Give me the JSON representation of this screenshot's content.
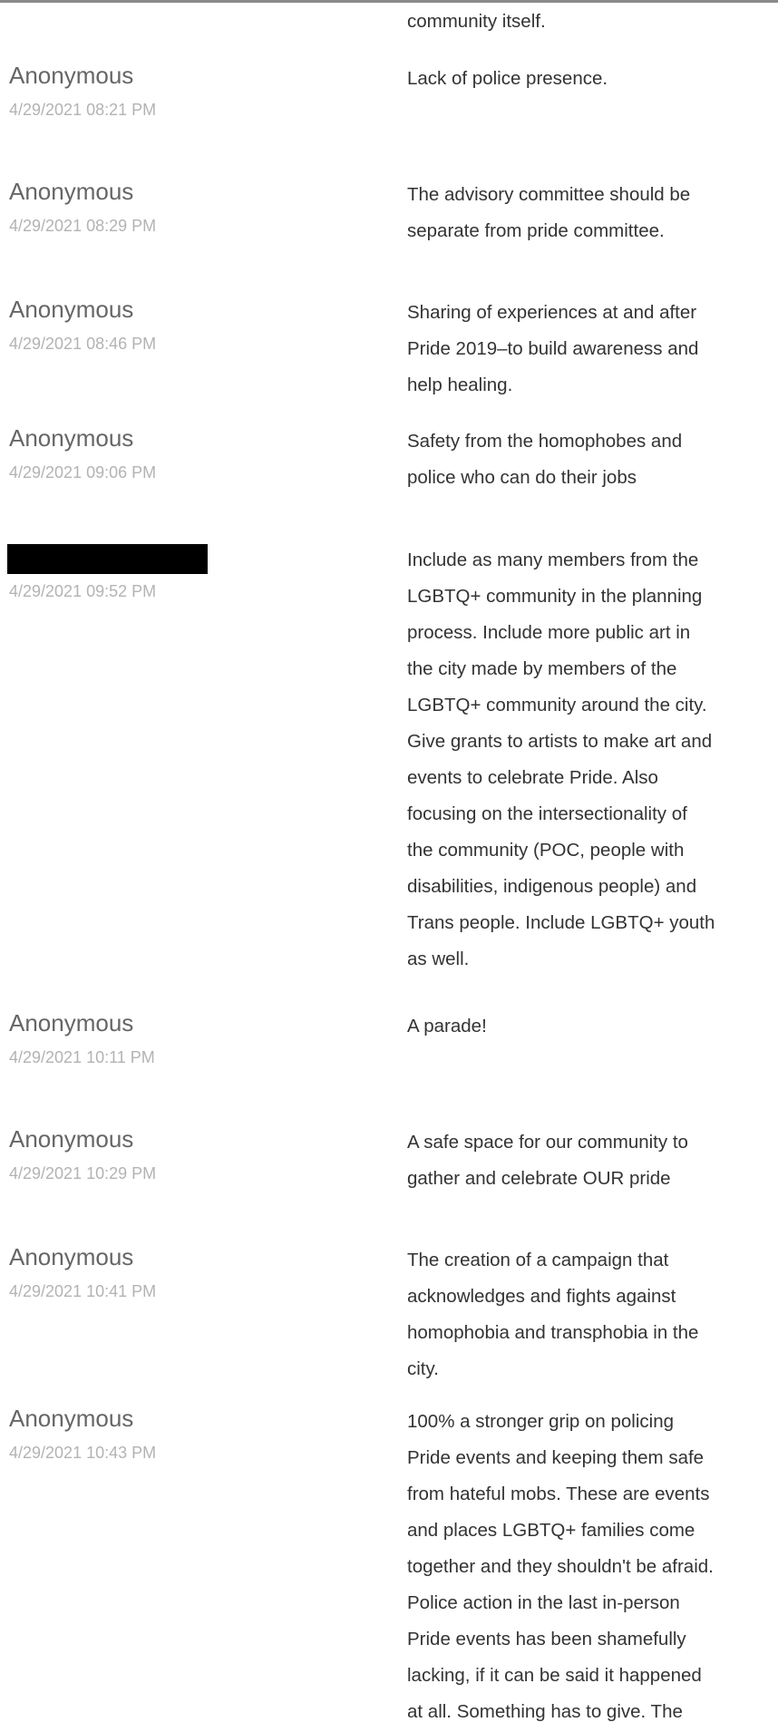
{
  "entries": [
    {
      "author": "",
      "timestamp": "",
      "response_lines": [
        "community itself."
      ]
    },
    {
      "author": "Anonymous",
      "timestamp": "4/29/2021 08:21 PM",
      "response_lines": [
        "Lack of police presence."
      ]
    },
    {
      "author": "Anonymous",
      "timestamp": "4/29/2021 08:29 PM",
      "response_lines": [
        "The advisory committee should be",
        "separate from pride committee."
      ]
    },
    {
      "author": "Anonymous",
      "timestamp": "4/29/2021 08:46 PM",
      "response_lines": [
        "Sharing of experiences at and after",
        "Pride 2019–to build awareness and",
        "help healing."
      ]
    },
    {
      "author": "Anonymous",
      "timestamp": "4/29/2021 09:06 PM",
      "response_lines": [
        "Safety from the homophobes and",
        "police who can do their jobs"
      ]
    },
    {
      "author": "",
      "author_redacted": true,
      "timestamp": "4/29/2021 09:52 PM",
      "response_lines": [
        "Include as many members from the",
        "LGBTQ+ community in the planning",
        "process. Include more public art in",
        "the city made by members of the",
        "LGBTQ+ community around the city.",
        "Give grants to artists to make art and",
        "events to celebrate Pride. Also",
        "focusing on the intersectionality of",
        "the community (POC, people with",
        "disabilities, indigenous people) and",
        "Trans people. Include LGBTQ+ youth",
        "as well."
      ]
    },
    {
      "author": "Anonymous",
      "timestamp": "4/29/2021 10:11 PM",
      "response_lines": [
        "A parade!"
      ]
    },
    {
      "author": "Anonymous",
      "timestamp": "4/29/2021 10:29 PM",
      "response_lines": [
        "A safe space for our community to",
        "gather and celebrate OUR pride"
      ]
    },
    {
      "author": "Anonymous",
      "timestamp": "4/29/2021 10:41 PM",
      "response_lines": [
        "The creation of a campaign that",
        "acknowledges and fights against",
        "homophobia and transphobia in the",
        "city."
      ]
    },
    {
      "author": "Anonymous",
      "timestamp": "4/29/2021 10:43 PM",
      "response_lines": [
        "100% a stronger grip on policing",
        "Pride events and keeping them safe",
        "from hateful mobs. These are events",
        "and places LGBTQ+ families come",
        "together and they shouldn't be afraid.",
        "Police action in the last in-person",
        "Pride events has been shamefully",
        "lacking, if it can be said it happened",
        "at all. Something has to give. The"
      ]
    }
  ]
}
